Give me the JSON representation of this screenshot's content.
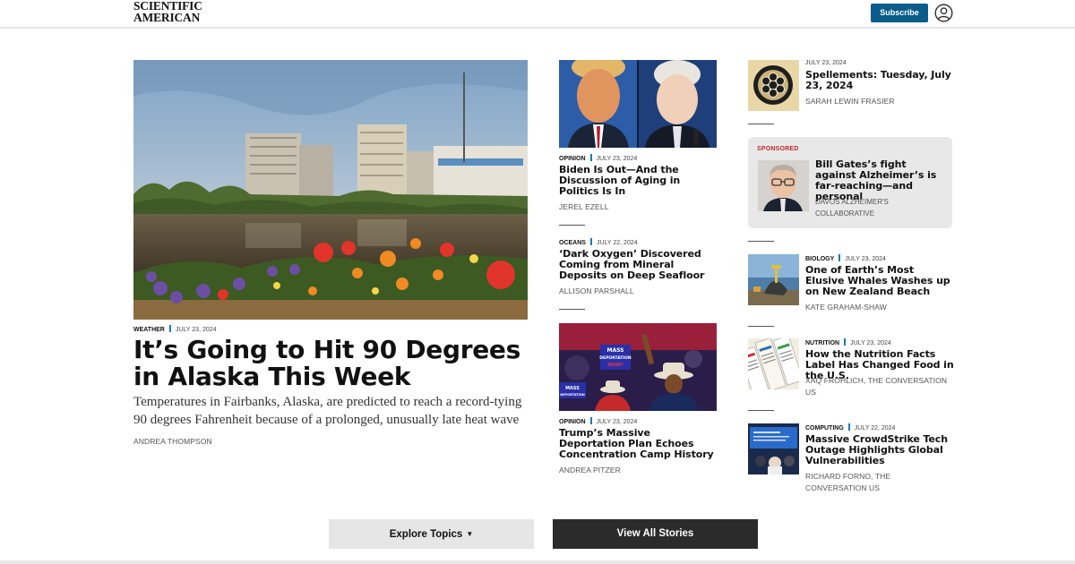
{
  "header": {
    "logo_line1": "SCIENTIFIC",
    "logo_line2": "AMERICAN",
    "subscribe_label": "Subscribe",
    "account_icon": "user-circle-icon"
  },
  "feature": {
    "category": "WEATHER",
    "date": "JULY 23, 2024",
    "title": "It’s Going to Hit 90 Degrees in Alaska This Week",
    "dek": "Temperatures in Fairbanks, Alaska, are predicted to reach a record-tying 90 degrees Fahrenheit because of a prolonged, unusually late heat wave",
    "byline": "ANDREA THOMPSON"
  },
  "middle": [
    {
      "category": "OPINION",
      "date": "JULY 23, 2024",
      "title": "Biden Is Out—And the Discussion of Aging in Politics Is In",
      "byline": "JEREL EZELL"
    },
    {
      "category": "OCEANS",
      "date": "JULY 22, 2024",
      "title": "‘Dark Oxygen’ Discovered Coming from Mineral Deposits on Deep Seafloor",
      "byline": "ALLISON PARSHALL"
    },
    {
      "category": "OPINION",
      "date": "JULY 23, 2024",
      "title": "Trump’s Massive Deportation Plan Echoes Concentration Camp History",
      "byline": "ANDREA PITZER",
      "sign_line1": "MASS",
      "sign_line2": "DEPORTATION",
      "sign_line3": "NOW!",
      "sign2_line1": "MASS",
      "sign2_line2": "DEPORTATION"
    }
  ],
  "right": {
    "spellements": {
      "date": "JULY 23, 2024",
      "title": "Spellements: Tuesday, July 23, 2024",
      "byline": "SARAH LEWIN FRASIER"
    },
    "sponsored": {
      "label": "SPONSORED",
      "title": "Bill Gates’s fight against Alzheimer’s is far-reaching—and personal",
      "byline": "DAVOS ALZHEIMER'S COLLABORATIVE"
    },
    "items": [
      {
        "category": "BIOLOGY",
        "date": "JULY 23, 2024",
        "title": "One of Earth’s Most Elusive Whales Washes up on New Zealand Beach",
        "byline": "KATE GRAHAM-SHAW"
      },
      {
        "category": "NUTRITION",
        "date": "JULY 23, 2024",
        "title": "How the Nutrition Facts Label Has Changed Food in the U.S.",
        "byline": "XAQ FROHLICH, THE CONVERSATION US"
      },
      {
        "category": "COMPUTING",
        "date": "JULY 22, 2024",
        "title": "Massive CrowdStrike Tech Outage Highlights Global Vulnerabilities",
        "byline": "RICHARD FORNO, THE CONVERSATION US"
      }
    ]
  },
  "buttons": {
    "explore_label": "Explore Topics",
    "explore_icon": "chevron-down-icon",
    "view_all_label": "View All Stories"
  }
}
